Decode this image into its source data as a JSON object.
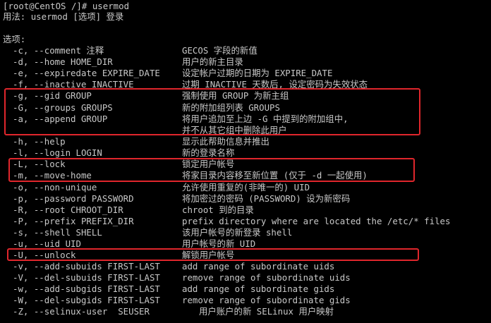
{
  "colors": {
    "background": "#000000",
    "text": "#c8c8c8",
    "highlight_box": "#e0262c"
  },
  "terminal": {
    "prompt_line": "[root@CentOS /]# usermod",
    "usage_line": "用法: usermod [选项] 登录",
    "blank": "",
    "options_header": "选项:",
    "options": [
      {
        "flag": "-c, --comment 注释",
        "desc": "GECOS 字段的新值"
      },
      {
        "flag": "-d, --home HOME_DIR",
        "desc": "用户的新主目录"
      },
      {
        "flag": "-e, --expiredate EXPIRE_DATE",
        "desc": "设定帐户过期的日期为 EXPIRE_DATE"
      },
      {
        "flag": "-f, --inactive INACTIVE",
        "desc": "过期 INACTIVE 天数后, 设定密码为失效状态"
      },
      {
        "flag": "-g, --gid GROUP",
        "desc": "强制使用 GROUP 为新主组"
      },
      {
        "flag": "-G, --groups GROUPS",
        "desc": "新的附加组列表 GROUPS"
      },
      {
        "flag": "-a, --append GROUP",
        "desc": "将用户追加至上边 -G 中提到的附加组中,"
      },
      {
        "flag": "",
        "desc": "并不从其它组中删除此用户"
      },
      {
        "flag": "-h, --help",
        "desc": "显示此帮助信息并推出"
      },
      {
        "flag": "-l, --login LOGIN",
        "desc": "新的登录名称"
      },
      {
        "flag": "-L, --lock",
        "desc": "锁定用户帐号"
      },
      {
        "flag": "-m, --move-home",
        "desc": "将家目录内容移至新位置 (仅于 -d 一起使用)"
      },
      {
        "flag": "-o, --non-unique",
        "desc": "允许使用重复的(非唯一的) UID"
      },
      {
        "flag": "-p, --password PASSWORD",
        "desc": "将加密过的密码 (PASSWORD) 设为新密码"
      },
      {
        "flag": "-R, --root CHROOT_DIR",
        "desc": "chroot 到的目录"
      },
      {
        "flag": "-P, --prefix PREFIX_DIR",
        "desc": "prefix directory where are located the /etc/* files"
      },
      {
        "flag": "-s, --shell SHELL",
        "desc": "该用户帐号的新登录 shell"
      },
      {
        "flag": "-u, --uid UID",
        "desc": "用户帐号的新 UID"
      },
      {
        "flag": "-U, --unlock",
        "desc": "解锁用户帐号"
      },
      {
        "flag": "-v, --add-subuids FIRST-LAST",
        "desc": "add range of subordinate uids"
      },
      {
        "flag": "-V, --del-subuids FIRST-LAST",
        "desc": "remove range of subordinate uids"
      },
      {
        "flag": "-w, --add-subgids FIRST-LAST",
        "desc": "add range of subordinate gids"
      },
      {
        "flag": "-W, --del-subgids FIRST-LAST",
        "desc": "remove range of subordinate gids"
      },
      {
        "flag": "-Z, --selinux-user  SEUSER",
        "desc": "用户账户的新 SELinux 用户映射"
      }
    ]
  }
}
